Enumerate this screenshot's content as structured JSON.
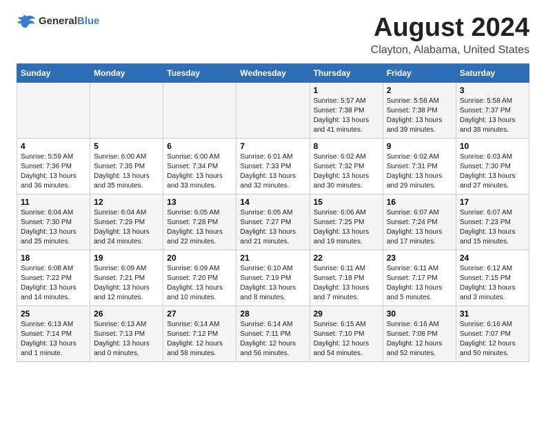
{
  "logo": {
    "general": "General",
    "blue": "Blue"
  },
  "title": "August 2024",
  "subtitle": "Clayton, Alabama, United States",
  "days_of_week": [
    "Sunday",
    "Monday",
    "Tuesday",
    "Wednesday",
    "Thursday",
    "Friday",
    "Saturday"
  ],
  "weeks": [
    [
      {
        "day": "",
        "info": ""
      },
      {
        "day": "",
        "info": ""
      },
      {
        "day": "",
        "info": ""
      },
      {
        "day": "",
        "info": ""
      },
      {
        "day": "1",
        "info": "Sunrise: 5:57 AM\nSunset: 7:38 PM\nDaylight: 13 hours and 41 minutes."
      },
      {
        "day": "2",
        "info": "Sunrise: 5:58 AM\nSunset: 7:38 PM\nDaylight: 13 hours and 39 minutes."
      },
      {
        "day": "3",
        "info": "Sunrise: 5:58 AM\nSunset: 7:37 PM\nDaylight: 13 hours and 38 minutes."
      }
    ],
    [
      {
        "day": "4",
        "info": "Sunrise: 5:59 AM\nSunset: 7:36 PM\nDaylight: 13 hours and 36 minutes."
      },
      {
        "day": "5",
        "info": "Sunrise: 6:00 AM\nSunset: 7:35 PM\nDaylight: 13 hours and 35 minutes."
      },
      {
        "day": "6",
        "info": "Sunrise: 6:00 AM\nSunset: 7:34 PM\nDaylight: 13 hours and 33 minutes."
      },
      {
        "day": "7",
        "info": "Sunrise: 6:01 AM\nSunset: 7:33 PM\nDaylight: 13 hours and 32 minutes."
      },
      {
        "day": "8",
        "info": "Sunrise: 6:02 AM\nSunset: 7:32 PM\nDaylight: 13 hours and 30 minutes."
      },
      {
        "day": "9",
        "info": "Sunrise: 6:02 AM\nSunset: 7:31 PM\nDaylight: 13 hours and 29 minutes."
      },
      {
        "day": "10",
        "info": "Sunrise: 6:03 AM\nSunset: 7:30 PM\nDaylight: 13 hours and 27 minutes."
      }
    ],
    [
      {
        "day": "11",
        "info": "Sunrise: 6:04 AM\nSunset: 7:30 PM\nDaylight: 13 hours and 25 minutes."
      },
      {
        "day": "12",
        "info": "Sunrise: 6:04 AM\nSunset: 7:29 PM\nDaylight: 13 hours and 24 minutes."
      },
      {
        "day": "13",
        "info": "Sunrise: 6:05 AM\nSunset: 7:28 PM\nDaylight: 13 hours and 22 minutes."
      },
      {
        "day": "14",
        "info": "Sunrise: 6:05 AM\nSunset: 7:27 PM\nDaylight: 13 hours and 21 minutes."
      },
      {
        "day": "15",
        "info": "Sunrise: 6:06 AM\nSunset: 7:25 PM\nDaylight: 13 hours and 19 minutes."
      },
      {
        "day": "16",
        "info": "Sunrise: 6:07 AM\nSunset: 7:24 PM\nDaylight: 13 hours and 17 minutes."
      },
      {
        "day": "17",
        "info": "Sunrise: 6:07 AM\nSunset: 7:23 PM\nDaylight: 13 hours and 15 minutes."
      }
    ],
    [
      {
        "day": "18",
        "info": "Sunrise: 6:08 AM\nSunset: 7:22 PM\nDaylight: 13 hours and 14 minutes."
      },
      {
        "day": "19",
        "info": "Sunrise: 6:09 AM\nSunset: 7:21 PM\nDaylight: 13 hours and 12 minutes."
      },
      {
        "day": "20",
        "info": "Sunrise: 6:09 AM\nSunset: 7:20 PM\nDaylight: 13 hours and 10 minutes."
      },
      {
        "day": "21",
        "info": "Sunrise: 6:10 AM\nSunset: 7:19 PM\nDaylight: 13 hours and 8 minutes."
      },
      {
        "day": "22",
        "info": "Sunrise: 6:11 AM\nSunset: 7:18 PM\nDaylight: 13 hours and 7 minutes."
      },
      {
        "day": "23",
        "info": "Sunrise: 6:11 AM\nSunset: 7:17 PM\nDaylight: 13 hours and 5 minutes."
      },
      {
        "day": "24",
        "info": "Sunrise: 6:12 AM\nSunset: 7:15 PM\nDaylight: 13 hours and 3 minutes."
      }
    ],
    [
      {
        "day": "25",
        "info": "Sunrise: 6:13 AM\nSunset: 7:14 PM\nDaylight: 13 hours and 1 minute."
      },
      {
        "day": "26",
        "info": "Sunrise: 6:13 AM\nSunset: 7:13 PM\nDaylight: 13 hours and 0 minutes."
      },
      {
        "day": "27",
        "info": "Sunrise: 6:14 AM\nSunset: 7:12 PM\nDaylight: 12 hours and 58 minutes."
      },
      {
        "day": "28",
        "info": "Sunrise: 6:14 AM\nSunset: 7:11 PM\nDaylight: 12 hours and 56 minutes."
      },
      {
        "day": "29",
        "info": "Sunrise: 6:15 AM\nSunset: 7:10 PM\nDaylight: 12 hours and 54 minutes."
      },
      {
        "day": "30",
        "info": "Sunrise: 6:16 AM\nSunset: 7:08 PM\nDaylight: 12 hours and 52 minutes."
      },
      {
        "day": "31",
        "info": "Sunrise: 6:16 AM\nSunset: 7:07 PM\nDaylight: 12 hours and 50 minutes."
      }
    ]
  ]
}
